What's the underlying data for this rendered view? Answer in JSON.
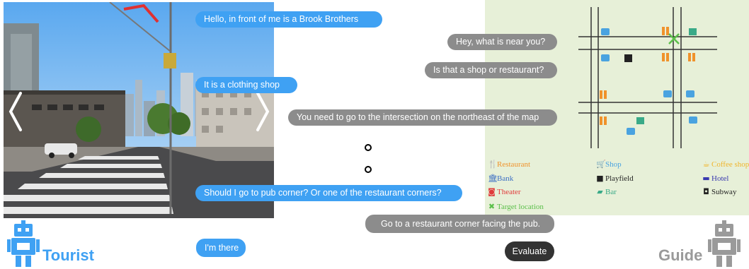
{
  "roles": {
    "tourist": "Tourist",
    "guide": "Guide"
  },
  "colors": {
    "tourist_bubble": "#3fa1f3",
    "guide_bubble": "#8c8c8c",
    "evaluate_button": "#333333",
    "map_background": "#e7f0d8"
  },
  "messages": [
    {
      "speaker": "tourist",
      "text": "Hello, in front of me is a Brook Brothers"
    },
    {
      "speaker": "guide",
      "text": "Hey, what is near you?"
    },
    {
      "speaker": "guide",
      "text": "Is that a shop or restaurant?"
    },
    {
      "speaker": "tourist",
      "text": "It is a clothing shop"
    },
    {
      "speaker": "guide",
      "text": "You need to go to the intersection on the northeast of the map"
    },
    {
      "speaker": "tourist",
      "text": "Should I go to pub corner? Or one of the restaurant corners?"
    },
    {
      "speaker": "guide",
      "text": "Go to a restaurant corner facing the pub."
    },
    {
      "speaker": "tourist",
      "text": "I'm there"
    }
  ],
  "evaluate_label": "Evaluate",
  "street_view": {
    "nav_left_icon": "chevron-left-icon",
    "nav_right_icon": "chevron-right-icon"
  },
  "map": {
    "legend": [
      {
        "icon": "restaurant-icon",
        "label": "Restaurant",
        "color": "#f0922b"
      },
      {
        "icon": "shop-icon",
        "label": "Shop",
        "color": "#4aa3e0"
      },
      {
        "icon": "coffee-shop-icon",
        "label": "Coffee shop",
        "color": "#f0b52b"
      },
      {
        "icon": "bank-icon",
        "label": "Bank",
        "color": "#3d6fc4"
      },
      {
        "icon": "playfield-icon",
        "label": "Playfield",
        "color": "#222222"
      },
      {
        "icon": "hotel-icon",
        "label": "Hotel",
        "color": "#3a3ab0"
      },
      {
        "icon": "theater-icon",
        "label": "Theater",
        "color": "#e03b3b"
      },
      {
        "icon": "bar-icon",
        "label": "Bar",
        "color": "#3aaa88"
      },
      {
        "icon": "subway-icon",
        "label": "Subway",
        "color": "#222222"
      },
      {
        "icon": "target-location-icon",
        "label": "Target location",
        "color": "#5bbf4a"
      }
    ]
  }
}
